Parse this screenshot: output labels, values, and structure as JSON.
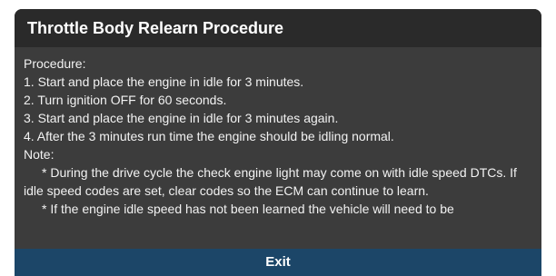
{
  "dialog": {
    "title": "Throttle Body Relearn Procedure",
    "procedure_label": "Procedure:",
    "steps": [
      "1. Start and place the engine in idle for 3 minutes.",
      "2. Turn ignition OFF for 60 seconds.",
      "3. Start and place the engine in idle for 3 minutes again.",
      "4. After the 3 minutes run time the engine should be idling normal."
    ],
    "note_label": "Note:",
    "notes": [
      "* During the drive cycle the check engine light may come on with idle speed DTCs. If idle speed codes are set, clear codes so the ECM can continue to learn.",
      "* If the engine idle speed has not been learned the vehicle will need to be"
    ],
    "exit_label": "Exit"
  },
  "colors": {
    "header_bg": "#2a2a2a",
    "body_bg": "#3c3c3c",
    "exit_bg": "#1c4668",
    "text": "#f2f2f2"
  }
}
